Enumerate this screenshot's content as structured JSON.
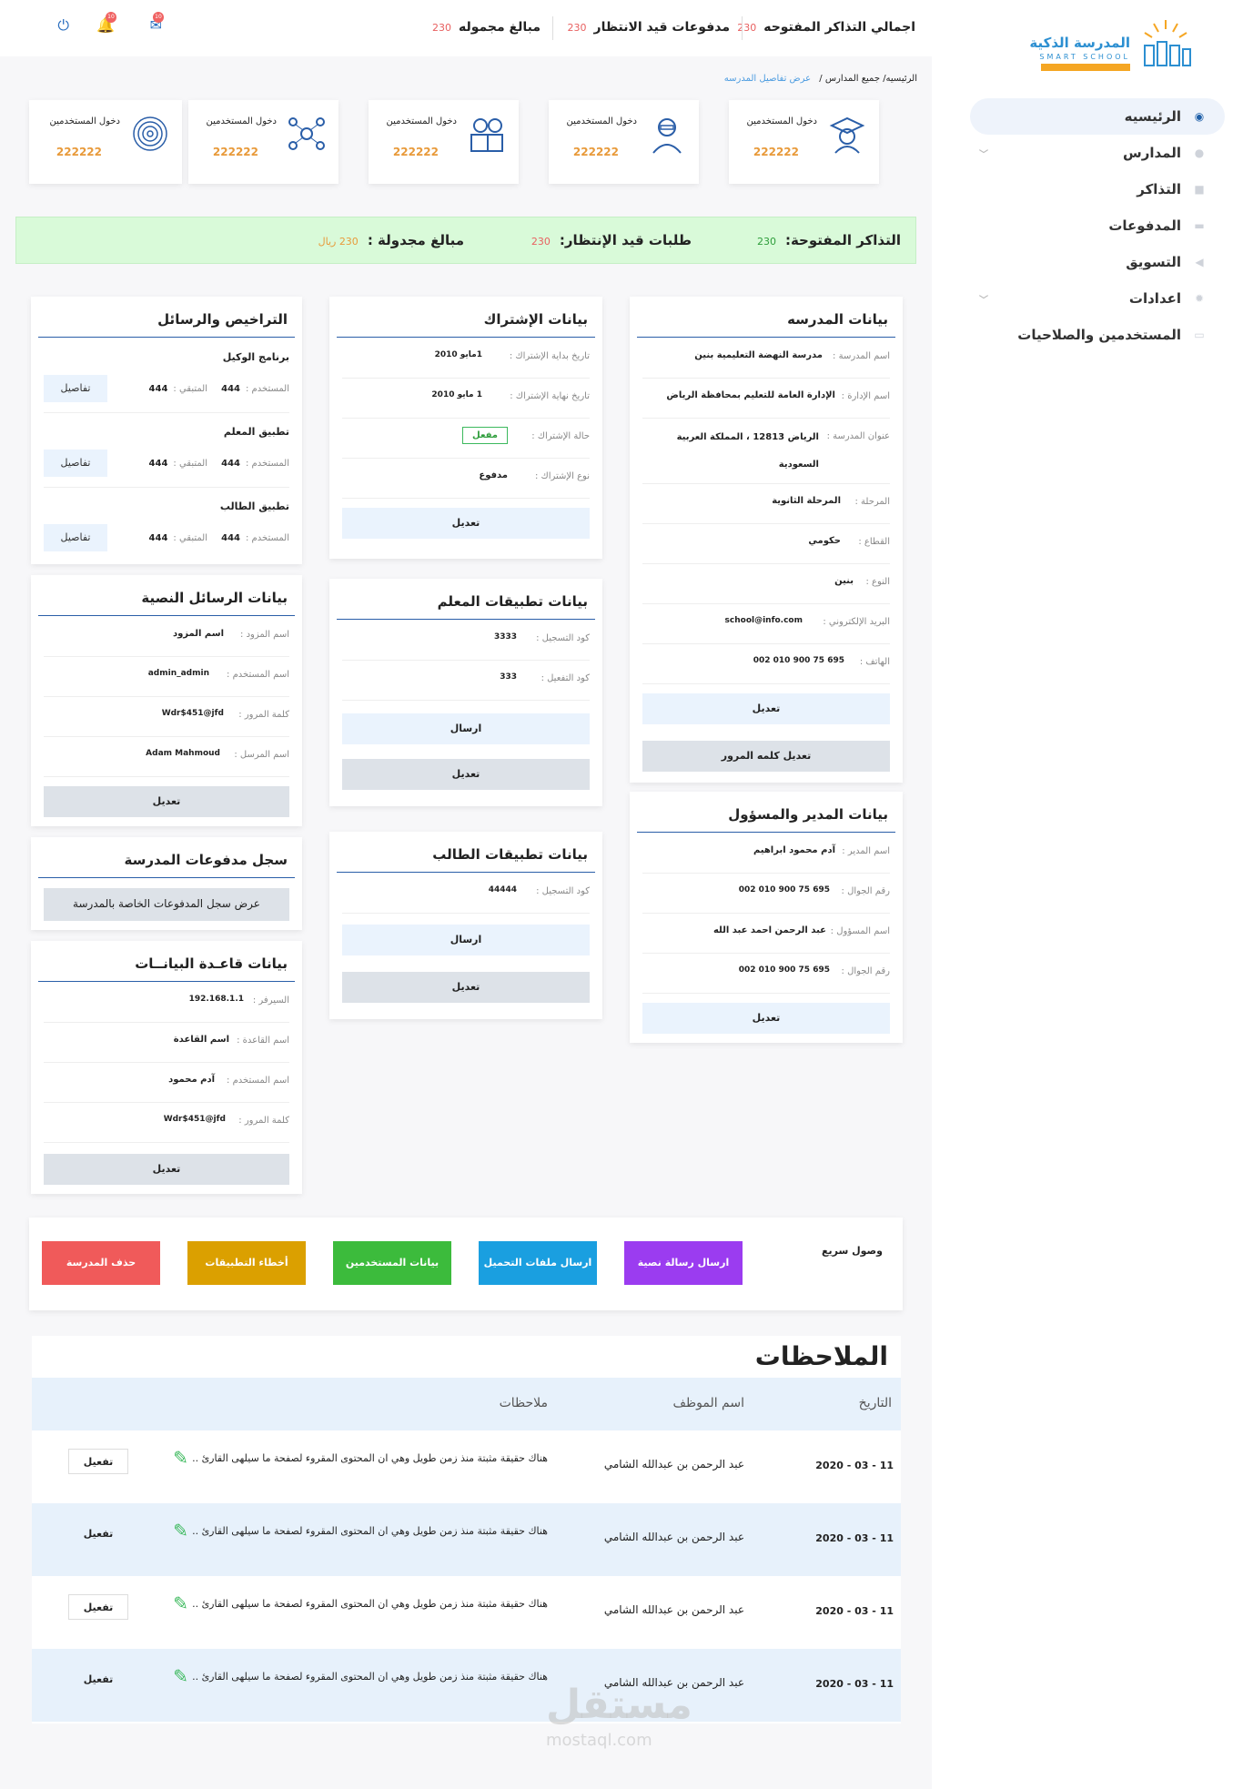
{
  "brand": {
    "name": "المدرسة الذكية",
    "sub": "SMART SCHOOL"
  },
  "sidebar": {
    "items": [
      {
        "label": "الرئيسيه",
        "icon": "dashboard-icon",
        "active": true
      },
      {
        "label": "المدارس",
        "icon": "users-icon",
        "has_children": true
      },
      {
        "label": "التذاكر",
        "icon": "ticket-icon"
      },
      {
        "label": "المدفوعات",
        "icon": "card-icon"
      },
      {
        "label": "التسويق",
        "icon": "megaphone-icon"
      },
      {
        "label": "اعدادات",
        "icon": "gear-icon",
        "has_children": true
      },
      {
        "label": "المستخدمين والصلاحيات",
        "icon": "folder-icon"
      }
    ]
  },
  "topbar": {
    "total_open_tickets": {
      "label": "اجمالي التذاكر المفتوحه",
      "value": "230"
    },
    "pending_payments": {
      "label": "مدفوعات قيد الانتظار",
      "value": "230"
    },
    "scheduled_amounts": {
      "label": "مبالغ مجموله",
      "value": "230"
    },
    "mail_badge": "10",
    "bell_badge": "10"
  },
  "breadcrumb": {
    "home": "الرئيسيه/",
    "schools": "جميع المدارس /",
    "current": "عرض تفاصيل المدرسه"
  },
  "user_cards": [
    {
      "label": "دخول المستخدمين",
      "value": "222222",
      "icon": "graduate-icon"
    },
    {
      "label": "دخول المستخدمين",
      "value": "222222",
      "icon": "teacher-icon"
    },
    {
      "label": "دخول المستخدمين",
      "value": "222222",
      "icon": "parents-icon"
    },
    {
      "label": "دخول المستخدمين",
      "value": "222222",
      "icon": "network-icon"
    },
    {
      "label": "دخول المستخدمين",
      "value": "222222",
      "icon": "fingerprint-icon"
    }
  ],
  "banner": {
    "open_tickets": {
      "label": "التذاكر المفتوحة:",
      "value": "230",
      "color": "#2e9d3b"
    },
    "pending_requests": {
      "label": "طلبات قيد الإنتظار:",
      "value": "230",
      "color": "#e86060"
    },
    "scheduled": {
      "label": "مبالغ مجدولة :",
      "value": "230 ريال",
      "color": "#e89a3a"
    }
  },
  "school_info": {
    "title": "بيانات المدرسه",
    "rows": [
      {
        "k": "اسم المدرسة :",
        "v": "مدرسة النهضة التعليمية بنين"
      },
      {
        "k": "اسم الإدارة :",
        "v": "الإدارة العامة للتعليم بمحافظة الرياض"
      },
      {
        "k": "عنوان المدرسة :",
        "v": "الرياض 12813 ، المملكة العربية السعودية"
      },
      {
        "k": "المرحلة :",
        "v": "المرحلة الثانوية"
      },
      {
        "k": "القطاع :",
        "v": "حكومي"
      },
      {
        "k": "النوع :",
        "v": "بنين"
      },
      {
        "k": "البريد الإلكتروني :",
        "v": "school@info.com"
      },
      {
        "k": "الهاتف :",
        "v": "695 75 900 010 002"
      }
    ],
    "edit": "تعديل",
    "change_password": "تعديل كلمه المرور"
  },
  "manager_info": {
    "title": "بيانات المدير والمسؤول",
    "rows": [
      {
        "k": "اسم المدير :",
        "v": "آدم محمود ابراهيم"
      },
      {
        "k": "رقم الجوال :",
        "v": "695 75 900 010 002"
      },
      {
        "k": "اسم المسؤول :",
        "v": "عبد الرحمن احمد عبد الله"
      },
      {
        "k": "رقم الجوال :",
        "v": "695 75 900 010 002"
      }
    ],
    "edit": "تعديل"
  },
  "subscription": {
    "title": "بيانات الإشتراك",
    "rows": [
      {
        "k": "تاريخ بداية الإشتراك :",
        "v": "1مايو 2010"
      },
      {
        "k": "تاريخ نهاية الإشتراك :",
        "v": "1 مايو 2010"
      },
      {
        "k": "حالة الإشتراك :",
        "v": "مفعل"
      },
      {
        "k": "نوع الإشتراك :",
        "v": "مدفوع"
      }
    ],
    "edit": "تعديل"
  },
  "teacher_apps": {
    "title": "بيانات تطبيقات المعلم",
    "rows": [
      {
        "k": "كود التسجيل :",
        "v": "3333"
      },
      {
        "k": "كود التفعيل :",
        "v": "333"
      }
    ],
    "send": "ارسال",
    "edit": "تعديل"
  },
  "student_apps": {
    "title": "بيانات تطبيقات الطالب",
    "rows": [
      {
        "k": "كود التسجيل :",
        "v": "44444"
      }
    ],
    "send": "ارسال",
    "edit": "تعديل"
  },
  "licenses": {
    "title": "التراخيص والرسائل",
    "apps": [
      {
        "name": "برنامج الوكيل",
        "users_label": "المستخدم :",
        "users": "444",
        "rem_label": "المتبقي :",
        "rem": "444",
        "details": "تفاصيل"
      },
      {
        "name": "تطبيق المعلم",
        "users_label": "المستخدم :",
        "users": "444",
        "rem_label": "المتبقي :",
        "rem": "444",
        "details": "تفاصيل"
      },
      {
        "name": "تطبيق الطالب",
        "users_label": "المستخدم :",
        "users": "444",
        "rem_label": "المتبقي :",
        "rem": "444",
        "details": "تفاصيل"
      }
    ]
  },
  "sms": {
    "title": "بيانات الرسائل النصية",
    "rows": [
      {
        "k": "اسم المزود :",
        "v": "اسم المزود"
      },
      {
        "k": "اسم المستخدم :",
        "v": "admin_admin"
      },
      {
        "k": "كلمة المرور :",
        "v": "Wdr$451@jfd"
      },
      {
        "k": "اسم المرسل :",
        "v": "Adam Mahmoud"
      }
    ],
    "edit": "تعديل"
  },
  "payments_log": {
    "title": "سجل مدفوعات المدرسة",
    "button": "عرض سجل المدفوعات الخاصة بالمدرسة"
  },
  "database": {
    "title": "بيانات قاعـدة البيانــات",
    "rows": [
      {
        "k": "السيرفر :",
        "v": "192.168.1.1"
      },
      {
        "k": "اسم القاعدة :",
        "v": "اسم القاعدة"
      },
      {
        "k": "اسم المستخدم :",
        "v": "آدم محمود"
      },
      {
        "k": "كلمة المرور :",
        "v": "Wdr$451@jfd"
      }
    ],
    "edit": "تعديل"
  },
  "quick": {
    "label": "وصول سريع",
    "buttons": [
      {
        "label": "ارسال رسالة نصية",
        "color": "#9b3cf0"
      },
      {
        "label": "ارسال ملفات التحميل",
        "color": "#1a9fe0"
      },
      {
        "label": "بيانات المستخدمين",
        "color": "#3cbb3c"
      },
      {
        "label": "أخطاء التطبيقات",
        "color": "#dba000"
      },
      {
        "label": "حذف المدرسة",
        "color": "#f05a5a"
      }
    ]
  },
  "notes": {
    "title": "الملاحظات",
    "headers": {
      "date": "التاريخ",
      "employee": "اسم الموظف",
      "notes": "ملاحظات"
    },
    "rows": [
      {
        "date": "11 - 03 - 2020",
        "employee": "عبد الرحمن بن عبدالله الشامي",
        "note": "هناك حقيقة مثبتة منذ زمن طويل وهي ان المحتوى المقروء لصفحة ما سيلهى القارئ ..",
        "action": "تفعيل"
      },
      {
        "date": "11 - 03 - 2020",
        "employee": "عبد الرحمن بن عبدالله الشامي",
        "note": "هناك حقيقة مثبتة منذ زمن طويل وهي ان المحتوى المقروء لصفحة ما سيلهى القارئ ..",
        "action": "تفعيل"
      },
      {
        "date": "11 - 03 - 2020",
        "employee": "عبد الرحمن بن عبدالله الشامي",
        "note": "هناك حقيقة مثبتة منذ زمن طويل وهي ان المحتوى المقروء لصفحة ما سيلهى القارئ ..",
        "action": "تفعيل"
      },
      {
        "date": "11 - 03 - 2020",
        "employee": "عبد الرحمن بن عبدالله الشامي",
        "note": "هناك حقيقة مثبتة منذ زمن طويل وهي ان المحتوى المقروء لصفحة ما سيلهى القارئ ..",
        "action": "تفعيل"
      }
    ]
  },
  "watermark": {
    "ar": "مستقل",
    "en": "mostaql.com"
  }
}
